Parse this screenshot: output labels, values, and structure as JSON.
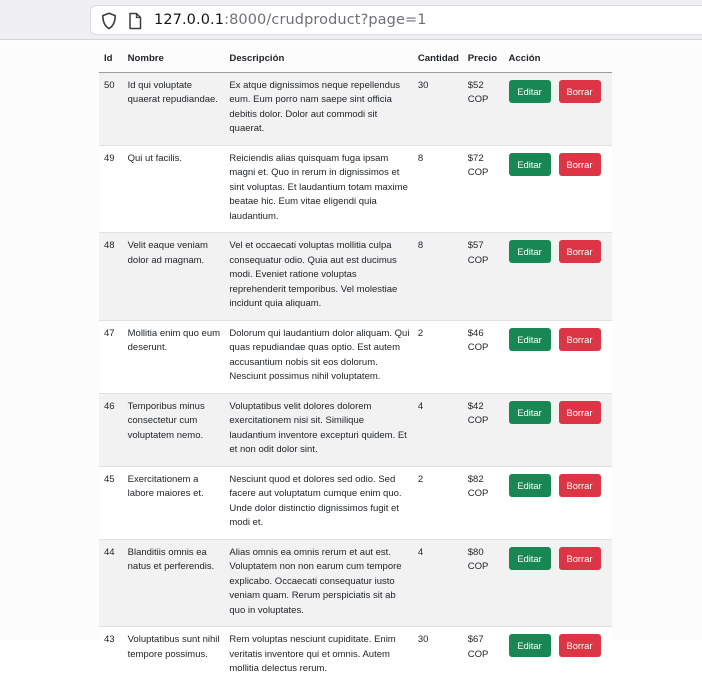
{
  "browser": {
    "url_host": "127.0.0.1",
    "url_rest": ":8000/crudproduct?page=1"
  },
  "table": {
    "headers": {
      "id": "Id",
      "nombre": "Nombre",
      "descripcion": "Descripción",
      "cantidad": "Cantidad",
      "precio": "Precio",
      "accion": "Acción"
    },
    "rows": [
      {
        "id": "50",
        "nombre": "Id qui voluptate quaerat repudiandae.",
        "descripcion": "Ex atque dignissimos neque repellendus eum. Eum porro nam saepe sint officia debitis dolor. Dolor aut commodi sit quaerat.",
        "cantidad": "30",
        "precio": "$52 COP",
        "edit_label": "Editar",
        "delete_label": "Borrar"
      },
      {
        "id": "49",
        "nombre": "Qui ut facilis.",
        "descripcion": "Reiciendis alias quisquam fuga ipsam magni et. Quo in rerum in dignissimos et sint voluptas. Et laudantium totam maxime beatae hic. Eum vitae eligendi quia laudantium.",
        "cantidad": "8",
        "precio": "$72 COP",
        "edit_label": "Editar",
        "delete_label": "Borrar"
      },
      {
        "id": "48",
        "nombre": "Velit eaque veniam dolor ad magnam.",
        "descripcion": "Vel et occaecati voluptas mollitia culpa consequatur odio. Quia aut est ducimus modi. Eveniet ratione voluptas reprehenderit temporibus. Vel molestiae incidunt quia aliquam.",
        "cantidad": "8",
        "precio": "$57 COP",
        "edit_label": "Editar",
        "delete_label": "Borrar"
      },
      {
        "id": "47",
        "nombre": "Mollitia enim quo eum deserunt.",
        "descripcion": "Dolorum qui laudantium dolor aliquam. Qui quas repudiandae quas optio. Est autem accusantium nobis sit eos dolorum. Nesciunt possimus nihil voluptatem.",
        "cantidad": "2",
        "precio": "$46 COP",
        "edit_label": "Editar",
        "delete_label": "Borrar"
      },
      {
        "id": "46",
        "nombre": "Temporibus minus consectetur cum voluptatem nemo.",
        "descripcion": "Voluptatibus velit dolores dolorem exercitationem nisi sit. Similique laudantium inventore excepturi quidem. Et et non odit dolor sint.",
        "cantidad": "4",
        "precio": "$42 COP",
        "edit_label": "Editar",
        "delete_label": "Borrar"
      },
      {
        "id": "45",
        "nombre": "Exercitationem a labore maiores et.",
        "descripcion": "Nesciunt quod et dolores sed odio. Sed facere aut voluptatum cumque enim quo. Unde dolor distinctio dignissimos fugit et modi et.",
        "cantidad": "2",
        "precio": "$82 COP",
        "edit_label": "Editar",
        "delete_label": "Borrar"
      },
      {
        "id": "44",
        "nombre": "Blanditiis omnis ea natus et perferendis.",
        "descripcion": "Alias omnis ea omnis rerum et aut est. Voluptatem non non earum cum tempore explicabo. Occaecati consequatur iusto veniam quam. Rerum perspiciatis sit ab quo in voluptates.",
        "cantidad": "4",
        "precio": "$80 COP",
        "edit_label": "Editar",
        "delete_label": "Borrar"
      },
      {
        "id": "43",
        "nombre": "Voluptatibus sunt nihil tempore possimus.",
        "descripcion": "Rem voluptas nesciunt cupiditate. Enim veritatis inventore qui et omnis. Autem mollitia delectus rerum.",
        "cantidad": "30",
        "precio": "$67 COP",
        "edit_label": "Editar",
        "delete_label": "Borrar"
      }
    ]
  }
}
